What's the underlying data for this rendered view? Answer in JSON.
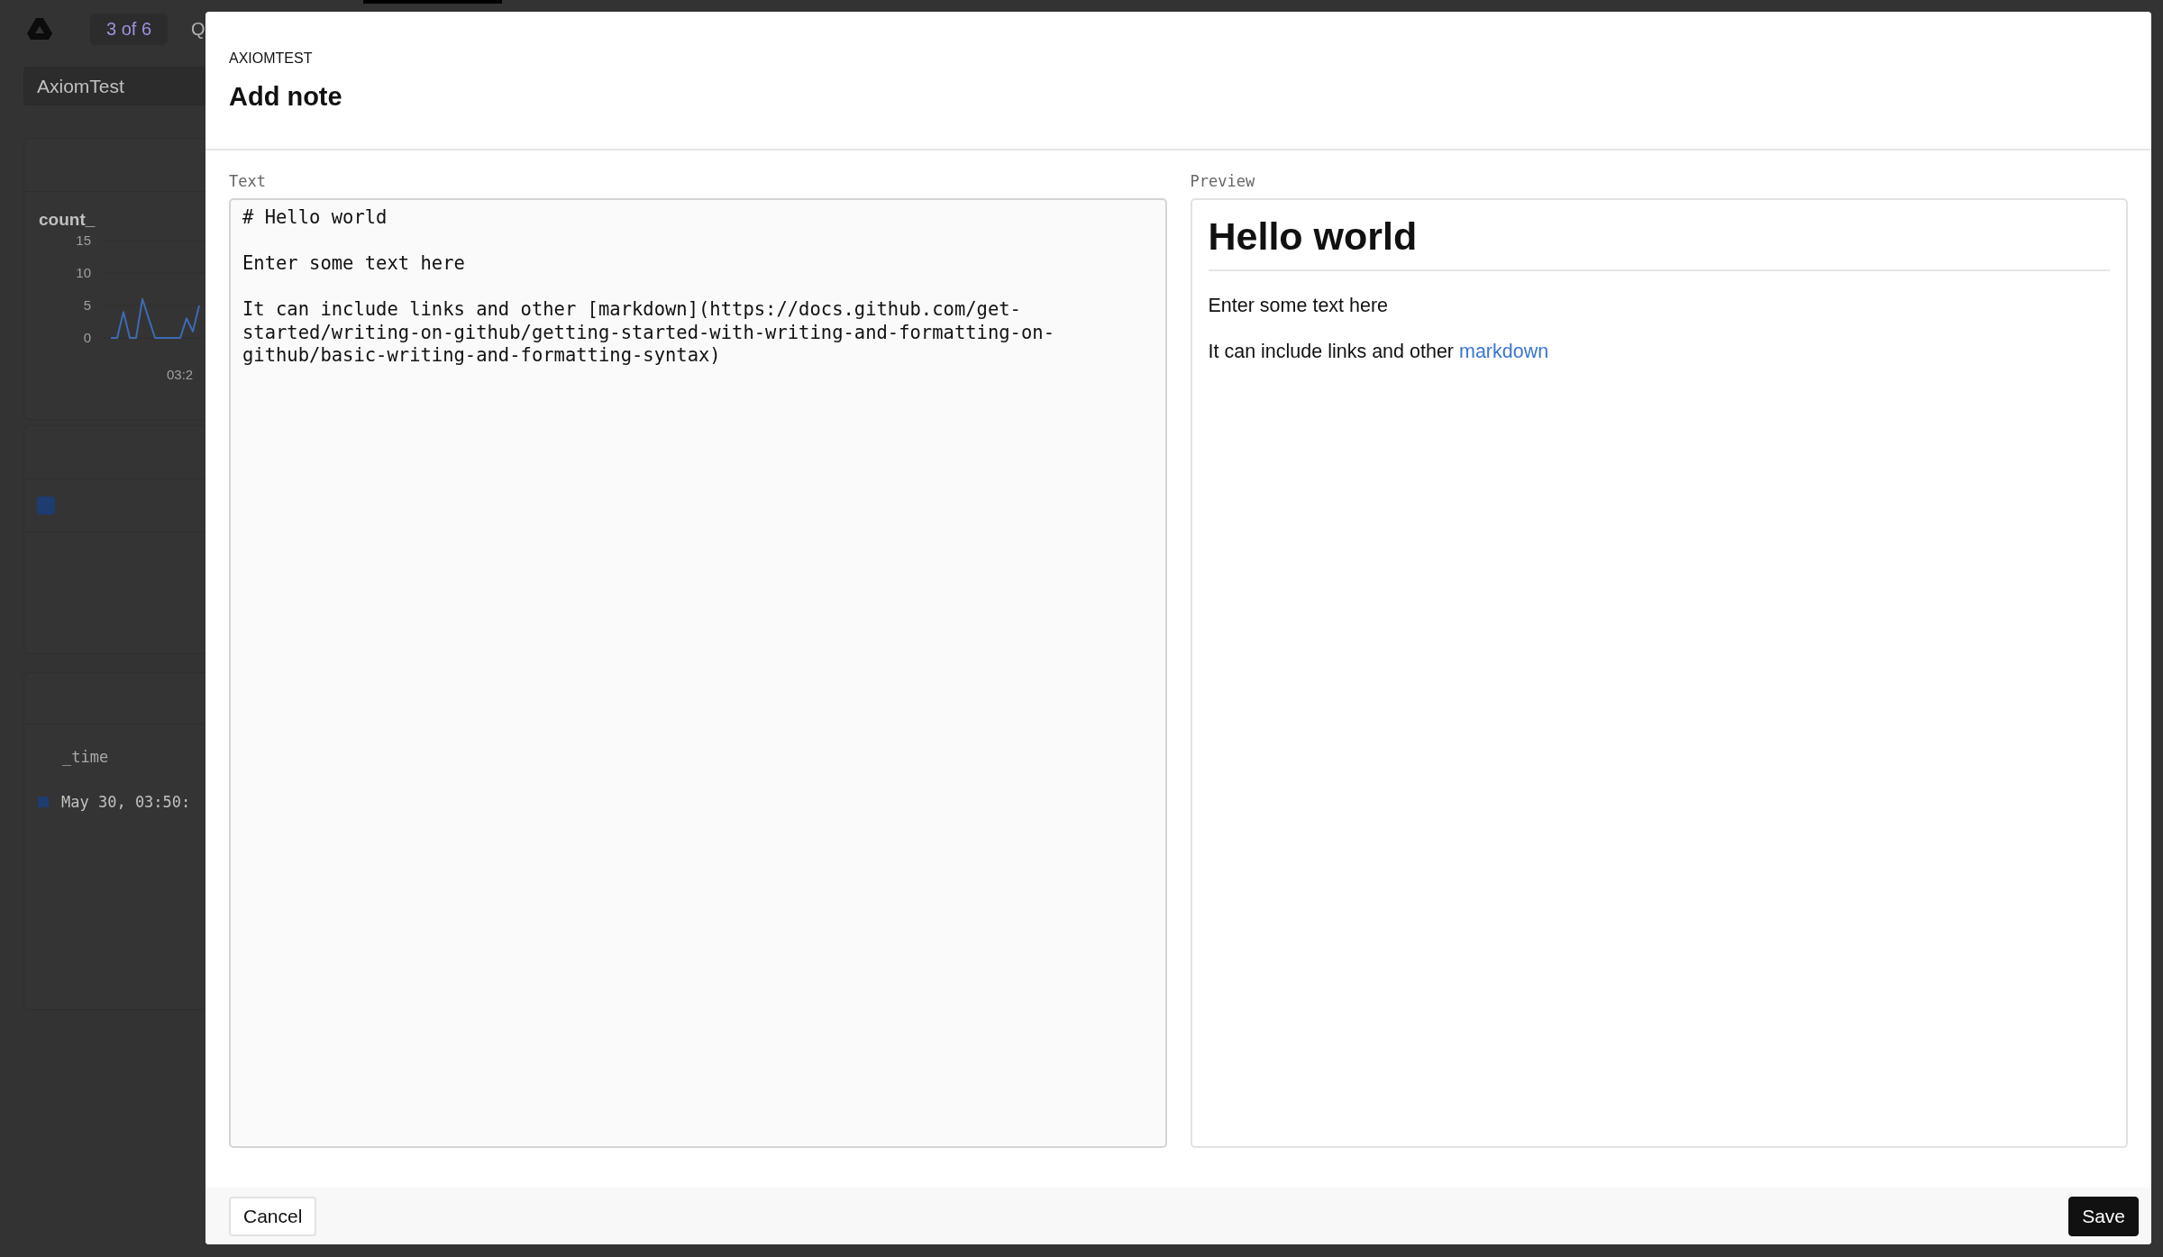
{
  "background": {
    "pager": "3 of 6",
    "tab_partial": "Q",
    "dataset_field": "AxiomTest",
    "chart": {
      "chart_data": {
        "type": "line",
        "title": "count_",
        "yticks": [
          0,
          5,
          10,
          15
        ],
        "ylim": [
          0,
          15
        ],
        "series": [
          {
            "color": "#3d6bb3",
            "values": [
              0,
              0,
              4,
              0,
              0,
              6,
              3,
              0,
              0,
              0,
              0,
              0,
              3,
              1,
              5
            ]
          }
        ]
      },
      "x_tick": "03:2"
    },
    "table": {
      "column": "_time",
      "row": "May 30, 03:50:"
    }
  },
  "modal": {
    "eyebrow": "AXIOMTEST",
    "title": "Add note",
    "editor": {
      "label": "Text",
      "value": "# Hello world\n\nEnter some text here\n\nIt can include links and other [markdown](https://docs.github.com/get-started/writing-on-github/getting-started-with-writing-and-formatting-on-github/basic-writing-and-formatting-syntax)"
    },
    "preview": {
      "label": "Preview",
      "blocks": [
        {
          "kind": "heading",
          "text": "Hello world"
        },
        {
          "kind": "paragraph",
          "text": "Enter some text here"
        },
        {
          "kind": "paragraph",
          "text": "It can include links and other ",
          "link": "markdown"
        }
      ]
    },
    "buttons": [
      {
        "label": "Cancel",
        "kind": "secondary"
      },
      {
        "label": "Save",
        "kind": "primary"
      }
    ]
  }
}
